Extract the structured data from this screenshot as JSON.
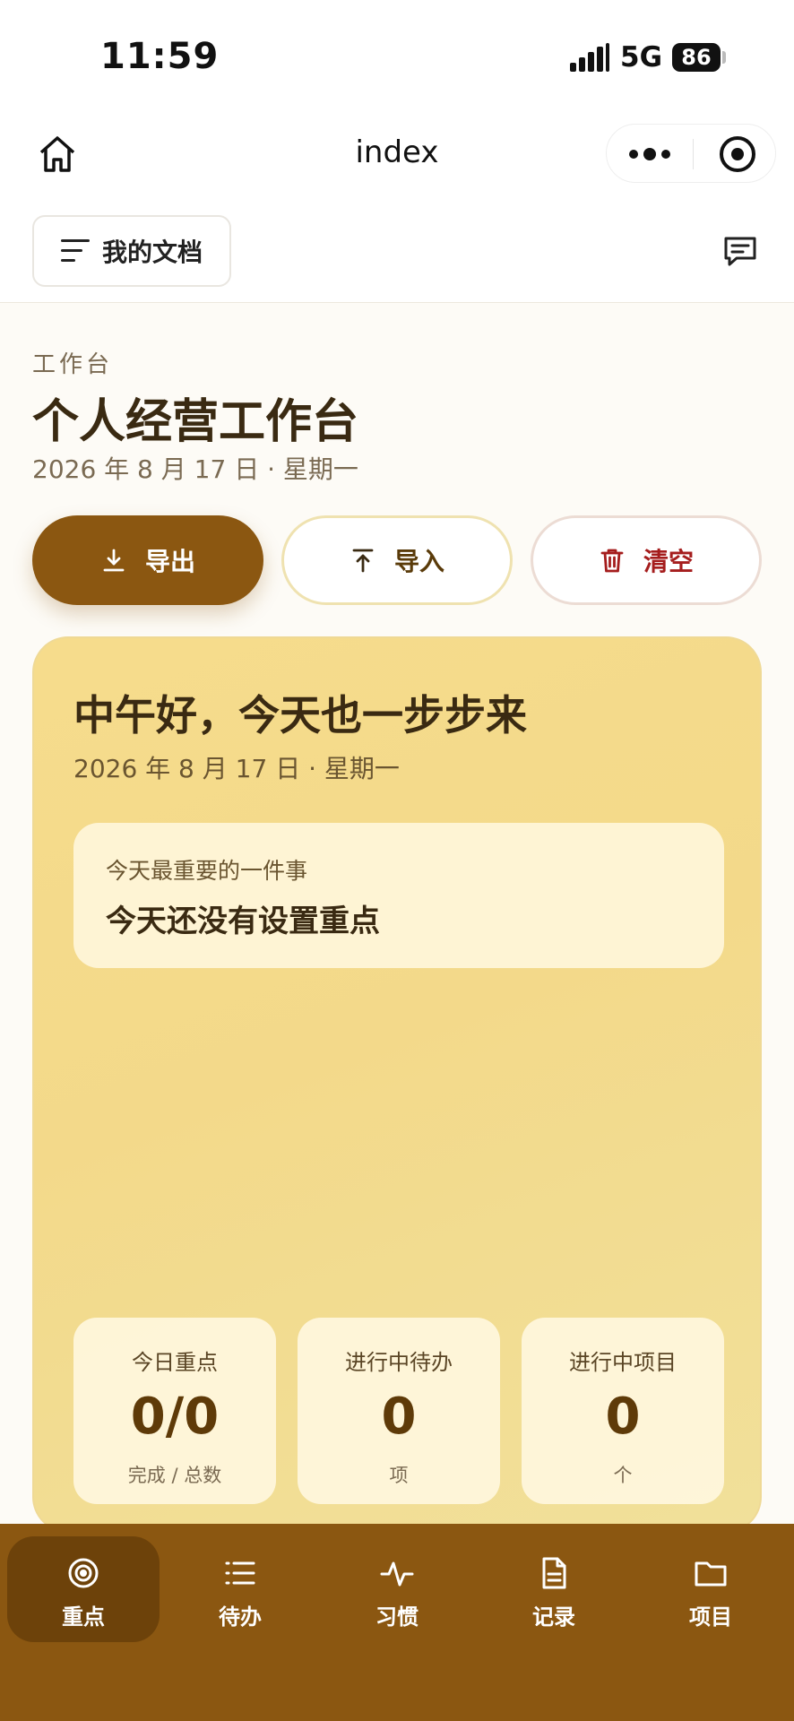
{
  "status_bar": {
    "time": "11:59",
    "network": "5G",
    "battery": "86"
  },
  "nav": {
    "title": "index"
  },
  "doc_bar": {
    "doc_button_label": "我的文档"
  },
  "header": {
    "section_label": "工作台",
    "title": "个人经营工作台",
    "date": "2026 年 8 月 17 日 · 星期一"
  },
  "actions": {
    "export_label": "导出",
    "import_label": "导入",
    "clear_label": "清空"
  },
  "hero": {
    "greeting": "中午好，今天也一步步来",
    "date": "2026 年 8 月 17 日 · 星期一",
    "focus_label": "今天最重要的一件事",
    "focus_value": "今天还没有设置重点"
  },
  "stats": [
    {
      "title": "今日重点",
      "value": "0/0",
      "unit": "完成 / 总数"
    },
    {
      "title": "进行中待办",
      "value": "0",
      "unit": "项"
    },
    {
      "title": "进行中项目",
      "value": "0",
      "unit": "个"
    }
  ],
  "tabs": [
    {
      "label": "重点",
      "icon": "target-icon",
      "active": true
    },
    {
      "label": "待办",
      "icon": "list-icon",
      "active": false
    },
    {
      "label": "习惯",
      "icon": "pulse-icon",
      "active": false
    },
    {
      "label": "记录",
      "icon": "document-icon",
      "active": false
    },
    {
      "label": "项目",
      "icon": "folder-icon",
      "active": false
    }
  ],
  "colors": {
    "accent": "#8b5711",
    "danger": "#a51d1d",
    "hero_bg": "#f6dc8c"
  }
}
